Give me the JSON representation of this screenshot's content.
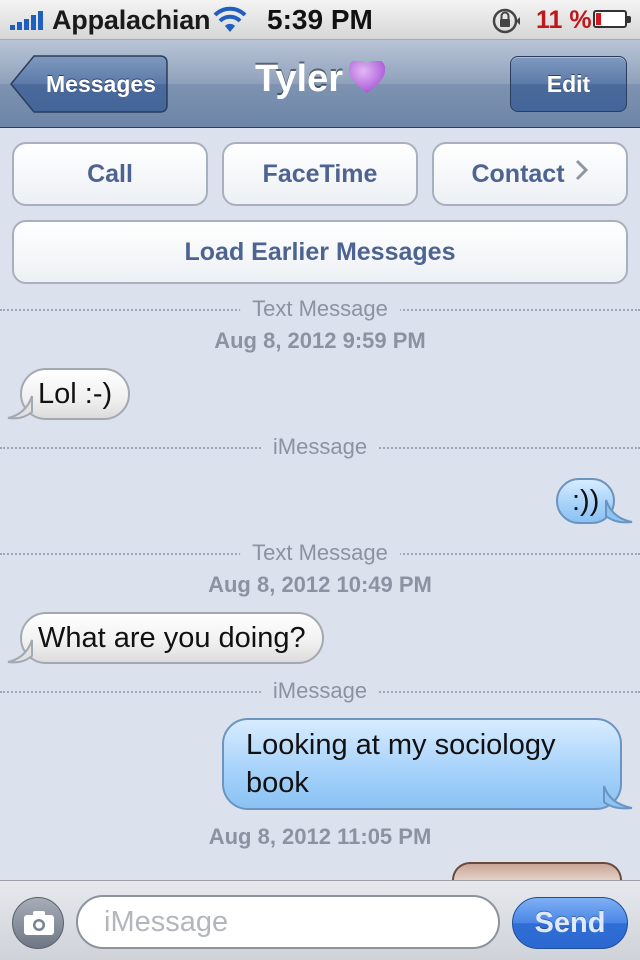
{
  "status_bar": {
    "carrier": "Appalachian",
    "time": "5:39 PM",
    "battery_percent": "11 %",
    "battery_level": 0.11,
    "signal_bars": 5,
    "colors": {
      "signal": "#1f5fbf",
      "battery_low": "#c0171b"
    }
  },
  "nav": {
    "back_label": "Messages",
    "title": "Tyler",
    "title_emoji": "purple-heart-icon",
    "edit_label": "Edit"
  },
  "actions": {
    "call": "Call",
    "facetime": "FaceTime",
    "contact": "Contact",
    "load_earlier": "Load Earlier Messages"
  },
  "thread": {
    "dividers": [
      "Text Message",
      "iMessage",
      "Text Message",
      "iMessage"
    ],
    "timestamps": [
      "Aug 8, 2012 9:59 PM",
      "Aug 8, 2012 10:49 PM",
      "Aug 8, 2012 11:05 PM"
    ],
    "messages": [
      {
        "direction": "received",
        "text": "Lol :-)"
      },
      {
        "direction": "sent",
        "text": ":))"
      },
      {
        "direction": "received",
        "text": "What are you doing?"
      },
      {
        "direction": "sent",
        "text": "Looking at my sociology book"
      }
    ]
  },
  "composer": {
    "placeholder": "iMessage",
    "send_label": "Send",
    "colors": {
      "send": "#2f6ed6"
    }
  }
}
